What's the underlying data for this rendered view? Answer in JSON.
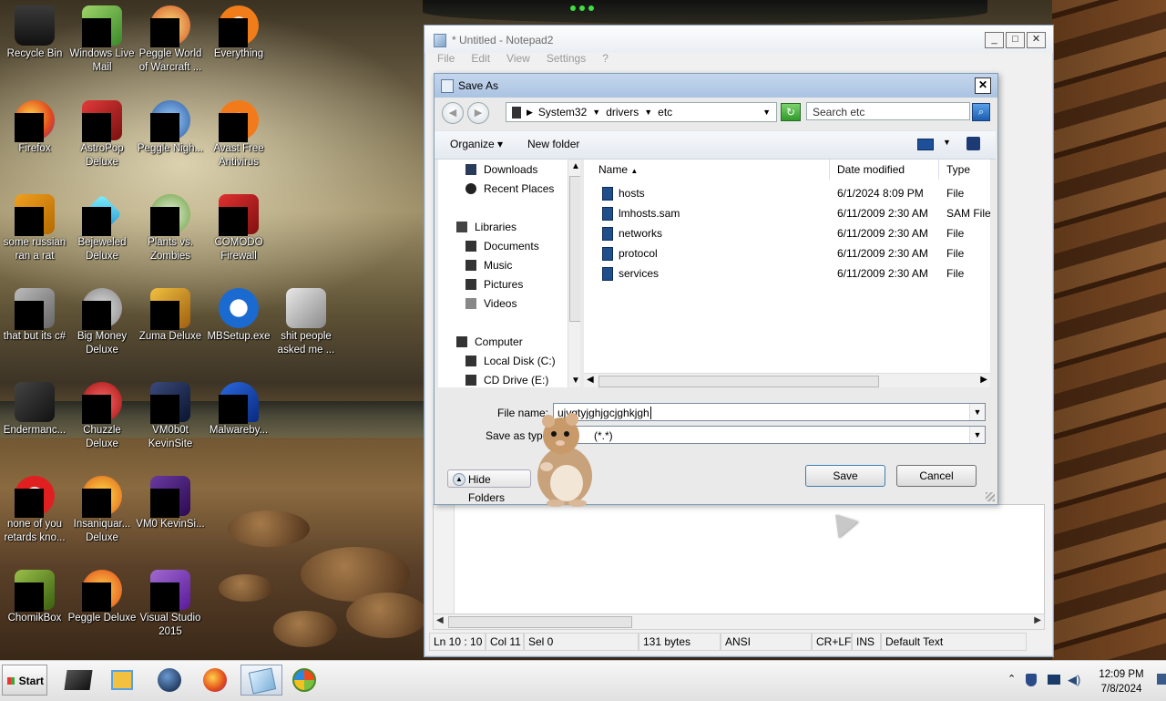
{
  "desktop": {
    "icons": [
      {
        "label": "Recycle Bin"
      },
      {
        "label": "Windows Live Mail"
      },
      {
        "label": "Peggle World of Warcraft ..."
      },
      {
        "label": "Everything"
      },
      {
        "label": "Firefox"
      },
      {
        "label": "AstroPop Deluxe"
      },
      {
        "label": "Peggle Nigh..."
      },
      {
        "label": "Avast Free Antivirus"
      },
      {
        "label": "some russian ran a rat"
      },
      {
        "label": "Bejeweled Deluxe"
      },
      {
        "label": "Plants vs. Zombies"
      },
      {
        "label": "COMODO Firewall"
      },
      {
        "label": "that but its c#"
      },
      {
        "label": "Big Money Deluxe"
      },
      {
        "label": "Zuma Deluxe"
      },
      {
        "label": "MBSetup.exe"
      },
      {
        "label": "shit people asked me ..."
      },
      {
        "label": "Endermanc..."
      },
      {
        "label": "Chuzzle Deluxe"
      },
      {
        "label": "VM0b0t KevinSite"
      },
      {
        "label": "Malwareby..."
      },
      {
        "label": "none of you retards kno..."
      },
      {
        "label": "Insaniquar... Deluxe"
      },
      {
        "label": "VM0 KevinSi..."
      },
      {
        "label": "ChomikBox"
      },
      {
        "label": "Peggle Deluxe"
      },
      {
        "label": "Visual Studio 2015"
      }
    ]
  },
  "notepad": {
    "title": "* Untitled - Notepad2",
    "menu": [
      "File",
      "Edit",
      "View",
      "Settings",
      "?"
    ],
    "controls": {
      "minimize": "_",
      "maximize": "□",
      "close": "✕"
    },
    "status": {
      "position": "Ln 10 : 10",
      "column": "Col 11",
      "selection": "Sel 0",
      "size": "131 bytes",
      "encoding": "ANSI",
      "line_endings": "CR+LF",
      "insert_mode": "INS",
      "scheme": "Default Text"
    }
  },
  "save_dialog": {
    "title": "Save As",
    "close": "✕",
    "breadcrumb": [
      "System32",
      "drivers",
      "etc"
    ],
    "search_placeholder": "Search etc",
    "toolbar": {
      "organize": "Organize",
      "new_folder": "New folder"
    },
    "nav_items": [
      {
        "label": "Downloads",
        "icon": "downloads-icon"
      },
      {
        "label": "Recent Places",
        "icon": "recent-places-icon"
      },
      {
        "label": "Libraries",
        "icon": "libraries-icon"
      },
      {
        "label": "Documents",
        "icon": "documents-icon"
      },
      {
        "label": "Music",
        "icon": "music-icon"
      },
      {
        "label": "Pictures",
        "icon": "pictures-icon"
      },
      {
        "label": "Videos",
        "icon": "videos-icon"
      },
      {
        "label": "Computer",
        "icon": "computer-icon"
      },
      {
        "label": "Local Disk (C:)",
        "icon": "drive-icon"
      },
      {
        "label": "CD Drive (E:)",
        "icon": "cd-drive-icon"
      }
    ],
    "columns": {
      "name": "Name",
      "date": "Date modified",
      "type": "Type"
    },
    "files": [
      {
        "name": "hosts",
        "date": "6/1/2024 8:09 PM",
        "type": "File"
      },
      {
        "name": "lmhosts.sam",
        "date": "6/11/2009 2:30 AM",
        "type": "SAM File"
      },
      {
        "name": "networks",
        "date": "6/11/2009 2:30 AM",
        "type": "File"
      },
      {
        "name": "protocol",
        "date": "6/11/2009 2:30 AM",
        "type": "File"
      },
      {
        "name": "services",
        "date": "6/11/2009 2:30 AM",
        "type": "File"
      }
    ],
    "file_name_label": "File name:",
    "file_name_value": "ujvgtyjghjgcjghkjgh",
    "save_type_label": "Save as type",
    "save_type_value": "(*.*)",
    "hide_folders": "Hide Folders",
    "save": "Save",
    "cancel": "Cancel"
  },
  "taskbar": {
    "start": "Start",
    "time": "12:09 PM",
    "date": "7/8/2024"
  }
}
